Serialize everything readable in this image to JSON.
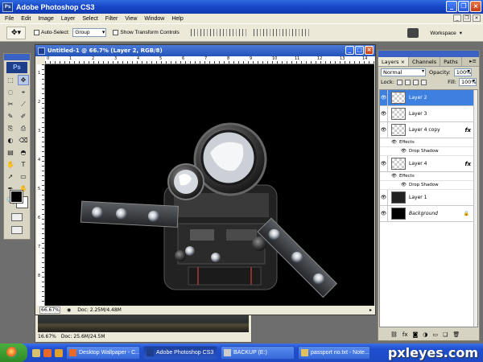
{
  "app": {
    "title": "Adobe Photoshop CS3",
    "icon_text": "Ps"
  },
  "menu": [
    "File",
    "Edit",
    "Image",
    "Layer",
    "Select",
    "Filter",
    "View",
    "Window",
    "Help"
  ],
  "options": {
    "auto_select_label": "Auto-Select:",
    "auto_select_value": "Group",
    "show_transform_label": "Show Transform Controls",
    "workspace_label": "Workspace"
  },
  "tools": {
    "logo": "Ps",
    "icons": [
      "⬚",
      "✥",
      "◌",
      "⌖",
      "✂",
      "⟋",
      "✎",
      "✐",
      "⎘",
      "⎙",
      "◐",
      "⌫",
      "▤",
      "◓",
      "✋",
      "T",
      "➚",
      "▭",
      "✒",
      "✋",
      "🔍",
      "⊙"
    ]
  },
  "document": {
    "title": "Untitled-1 @ 66.7% (Layer 2, RGB/8)",
    "zoom": "66.67%",
    "doc_size": "Doc: 2.25M/4.48M",
    "ruler_h": [
      "0",
      "1",
      "2",
      "3",
      "4",
      "5",
      "6",
      "7",
      "8",
      "9",
      "10",
      "11",
      "12",
      "13",
      "14"
    ],
    "ruler_v": [
      "1",
      "2",
      "3",
      "4",
      "5",
      "6",
      "7",
      "8"
    ]
  },
  "document2": {
    "zoom": "16.67%",
    "doc_size": "Doc: 25.6M/24.5M"
  },
  "layers_panel": {
    "tabs": [
      "Layers ×",
      "Channels",
      "Paths"
    ],
    "blend_mode": "Normal",
    "opacity_label": "Opacity:",
    "opacity_value": "100%",
    "lock_label": "Lock:",
    "fill_label": "Fill:",
    "fill_value": "100%",
    "layers": [
      {
        "name": "Layer 2",
        "selected": true
      },
      {
        "name": "Layer 3"
      },
      {
        "name": "Layer 4 copy",
        "fx": "fx"
      },
      {
        "name": "Layer 4",
        "fx": "fx"
      },
      {
        "name": "Layer 1"
      },
      {
        "name": "Background"
      }
    ],
    "effects_label": "Effects",
    "drop_shadow_label": "Drop Shadow"
  },
  "taskbar": {
    "tasks": [
      "Desktop Wallpaper - C...",
      "Adobe Photoshop CS3",
      "BACKUP (E:)",
      "passport no.txt - Note..."
    ]
  },
  "watermark": "pxleyes.com"
}
